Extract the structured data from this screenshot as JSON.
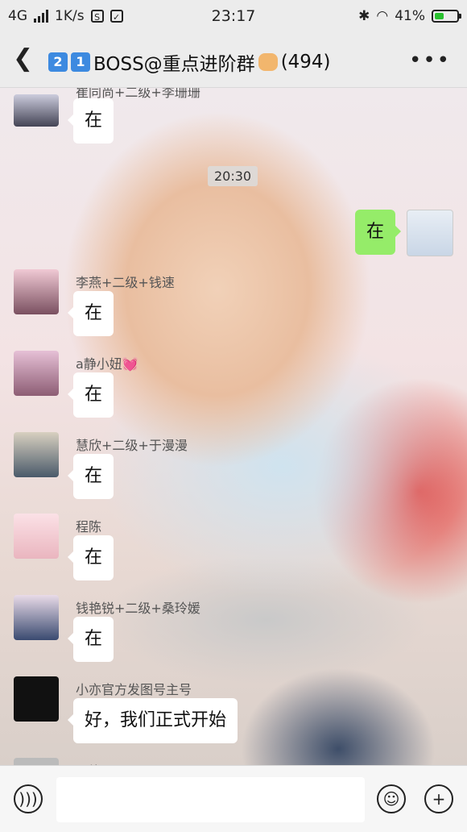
{
  "status_bar": {
    "network": "4G",
    "speed": "1K/s",
    "s_icon_label": "S",
    "time": "23:17",
    "battery_percent": "41%",
    "battery_level": 0.41
  },
  "header": {
    "title_main": "BOSS@重点进阶群",
    "member_count": "(494)",
    "keycap_1": "2",
    "keycap_2": "1"
  },
  "chat": {
    "timestamp": "20:30",
    "messages": [
      {
        "sender": "崔同尚+二级+李珊珊",
        "text": "在"
      },
      {
        "sender": "",
        "text": "在",
        "self": true
      },
      {
        "sender": "李燕+二级+钱速",
        "text": "在"
      },
      {
        "sender": "a静小妞💓",
        "text": "在"
      },
      {
        "sender": "慧欣+二级+于漫漫",
        "text": "在"
      },
      {
        "sender": "程陈",
        "text": "在"
      },
      {
        "sender": "钱艳锐+二级+桑玲媛",
        "text": "在"
      },
      {
        "sender": "小亦官方发图号主号",
        "text": "好，我们正式开始"
      },
      {
        "sender": "阿旋",
        "text": ""
      }
    ]
  },
  "input_bar": {
    "voice_icon": "voice-icon",
    "emoji_icon": "emoji-icon",
    "plus_icon": "plus-icon"
  }
}
